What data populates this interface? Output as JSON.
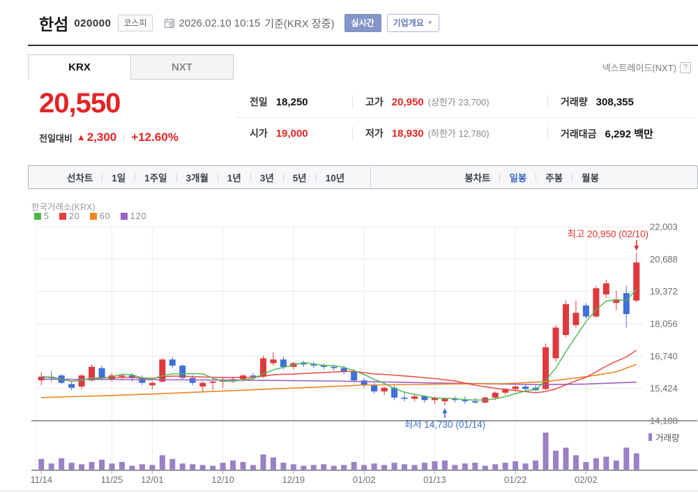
{
  "header": {
    "stock_name": "한섬",
    "stock_code": "020000",
    "market_badge": "코스피",
    "timestamp": "2026.02.10 10:15",
    "timestamp_suffix": "기준(KRX 장중)",
    "realtime_label": "실시간",
    "company_overview_label": "기업개요",
    "nxt_link": "넥스트레이드(NXT)",
    "help_icon": "?"
  },
  "tabs": {
    "krx": "KRX",
    "nxt": "NXT"
  },
  "price": {
    "current": "20,550",
    "change_label": "전일대비",
    "change_arrow": "▲",
    "change_value": "2,300",
    "change_percent": "+12.60%"
  },
  "info": {
    "prev": {
      "label": "전일",
      "value": "18,250"
    },
    "high": {
      "label": "고가",
      "value": "20,950",
      "paren": "(상한가 23,700)"
    },
    "volume": {
      "label": "거래량",
      "value": "308,355"
    },
    "open": {
      "label": "시가",
      "value": "19,000"
    },
    "low": {
      "label": "저가",
      "value": "18,930",
      "paren": "(하한가 12,780)"
    },
    "amount": {
      "label": "거래대금",
      "value": "6,292 백만"
    }
  },
  "toolbar": {
    "line_chart": "선차트",
    "ranges": [
      "1일",
      "1주일",
      "3개월",
      "1년",
      "3년",
      "5년",
      "10년"
    ],
    "candle_chart": "봉차트",
    "periods": [
      "일봉",
      "주봉",
      "월봉"
    ],
    "active_period": "일봉"
  },
  "chart_data": {
    "type": "candlestick",
    "title": "한국거래소(KRX)",
    "ma_labels": [
      "5",
      "20",
      "60",
      "120"
    ],
    "ma_colors": [
      "#4cb749",
      "#e8403f",
      "#f0861f",
      "#9d60c9"
    ],
    "up_color": "#e0393d",
    "down_color": "#3f6fd8",
    "volume_color": "#9b80c6",
    "volume_label": "거래량",
    "y_ticks": [
      "22,003",
      "20,688",
      "19,372",
      "18,056",
      "16,740",
      "15,424",
      "14,108"
    ],
    "y_tick_values": [
      22003,
      20688,
      19372,
      18056,
      16740,
      15424,
      14108
    ],
    "x_ticks": [
      {
        "label": "11/14",
        "i": 0
      },
      {
        "label": "11/25",
        "i": 7
      },
      {
        "label": "12/01",
        "i": 11
      },
      {
        "label": "12/10",
        "i": 18
      },
      {
        "label": "12/19",
        "i": 25
      },
      {
        "label": "01/02",
        "i": 32
      },
      {
        "label": "01/13",
        "i": 39
      },
      {
        "label": "01/22",
        "i": 47
      },
      {
        "label": "02/02",
        "i": 54
      }
    ],
    "annotations": {
      "high": {
        "text": "최고 20,950 (02/10)",
        "index": 59,
        "price": 20950,
        "color": "#e0302f"
      },
      "low": {
        "text": "최저 14,730 (01/14)",
        "index": 40,
        "price": 14730,
        "color": "#3a6bc5"
      }
    },
    "candles": [
      [
        15750,
        16100,
        15550,
        15900
      ],
      [
        15900,
        16150,
        15700,
        15850
      ],
      [
        15950,
        16000,
        15600,
        15650
      ],
      [
        15600,
        15700,
        15350,
        15450
      ],
      [
        15500,
        16000,
        15400,
        15950
      ],
      [
        15750,
        16400,
        15700,
        16300
      ],
      [
        16250,
        16350,
        15750,
        15850
      ],
      [
        15800,
        16050,
        15700,
        15950
      ],
      [
        15900,
        16000,
        15750,
        15950
      ],
      [
        15950,
        16050,
        15700,
        15850
      ],
      [
        15850,
        15950,
        15550,
        15650
      ],
      [
        15550,
        15700,
        15400,
        15650
      ],
      [
        15700,
        16650,
        15650,
        16600
      ],
      [
        16600,
        16700,
        16250,
        16350
      ],
      [
        16350,
        16400,
        15750,
        15850
      ],
      [
        15850,
        15950,
        15550,
        15650
      ],
      [
        15500,
        15700,
        15250,
        15650
      ],
      [
        15650,
        15800,
        15350,
        15700
      ],
      [
        15700,
        15850,
        15450,
        15750
      ],
      [
        15750,
        15900,
        15650,
        15800
      ],
      [
        15800,
        16000,
        15700,
        15950
      ],
      [
        15950,
        16050,
        15800,
        15900
      ],
      [
        15900,
        16750,
        15850,
        16650
      ],
      [
        16450,
        16900,
        16350,
        16600
      ],
      [
        16600,
        16700,
        16200,
        16300
      ],
      [
        16300,
        16500,
        16200,
        16450
      ],
      [
        16450,
        16550,
        16300,
        16400
      ],
      [
        16400,
        16500,
        16250,
        16350
      ],
      [
        16350,
        16450,
        16200,
        16300
      ],
      [
        16300,
        16400,
        16150,
        16250
      ],
      [
        16250,
        16350,
        16000,
        16100
      ],
      [
        16100,
        16200,
        15650,
        15750
      ],
      [
        15750,
        15850,
        15450,
        15550
      ],
      [
        15550,
        15650,
        15200,
        15300
      ],
      [
        15300,
        15500,
        15150,
        15450
      ],
      [
        15450,
        15550,
        14950,
        15050
      ],
      [
        15050,
        15250,
        14900,
        15000
      ],
      [
        15000,
        15200,
        14900,
        15100
      ],
      [
        15100,
        15150,
        14850,
        14950
      ],
      [
        14950,
        15100,
        14800,
        15050
      ],
      [
        14900,
        15050,
        14730,
        15000
      ],
      [
        15000,
        15100,
        14850,
        14950
      ],
      [
        14950,
        15100,
        14800,
        14900
      ],
      [
        14900,
        15050,
        14800,
        14850
      ],
      [
        14850,
        15100,
        14800,
        15050
      ],
      [
        15050,
        15300,
        14950,
        15250
      ],
      [
        15250,
        15450,
        15150,
        15400
      ],
      [
        15400,
        15550,
        15300,
        15500
      ],
      [
        15500,
        15600,
        15350,
        15400
      ],
      [
        15450,
        15550,
        15300,
        15350
      ],
      [
        15400,
        17250,
        15350,
        17100
      ],
      [
        16650,
        18000,
        16500,
        17900
      ],
      [
        17600,
        19000,
        17500,
        18850
      ],
      [
        18000,
        19000,
        17900,
        18500
      ],
      [
        18800,
        18900,
        18250,
        18350
      ],
      [
        18350,
        19600,
        18300,
        19500
      ],
      [
        19250,
        19850,
        19100,
        19700
      ],
      [
        18900,
        19400,
        18600,
        19050
      ],
      [
        19300,
        19600,
        17900,
        18450
      ],
      [
        19000,
        20950,
        18930,
        20550
      ]
    ],
    "volumes": [
      30,
      18,
      32,
      20,
      16,
      22,
      28,
      18,
      22,
      12,
      16,
      14,
      40,
      30,
      18,
      16,
      14,
      12,
      20,
      26,
      22,
      14,
      42,
      34,
      20,
      16,
      12,
      14,
      16,
      12,
      14,
      22,
      14,
      18,
      14,
      20,
      16,
      14,
      20,
      24,
      26,
      14,
      18,
      20,
      12,
      16,
      20,
      24,
      18,
      26,
      100,
      52,
      60,
      40,
      22,
      32,
      36,
      26,
      60,
      45
    ],
    "ma60": [
      [
        0,
        15050
      ],
      [
        8,
        15150
      ],
      [
        16,
        15280
      ],
      [
        24,
        15420
      ],
      [
        32,
        15560
      ],
      [
        40,
        15600
      ],
      [
        46,
        15620
      ],
      [
        50,
        15700
      ],
      [
        54,
        15900
      ],
      [
        57,
        16100
      ],
      [
        59,
        16400
      ]
    ],
    "ma120": [
      [
        0,
        15800
      ],
      [
        10,
        15780
      ],
      [
        20,
        15760
      ],
      [
        30,
        15720
      ],
      [
        40,
        15640
      ],
      [
        46,
        15600
      ],
      [
        50,
        15580
      ],
      [
        54,
        15600
      ],
      [
        59,
        15680
      ]
    ]
  }
}
